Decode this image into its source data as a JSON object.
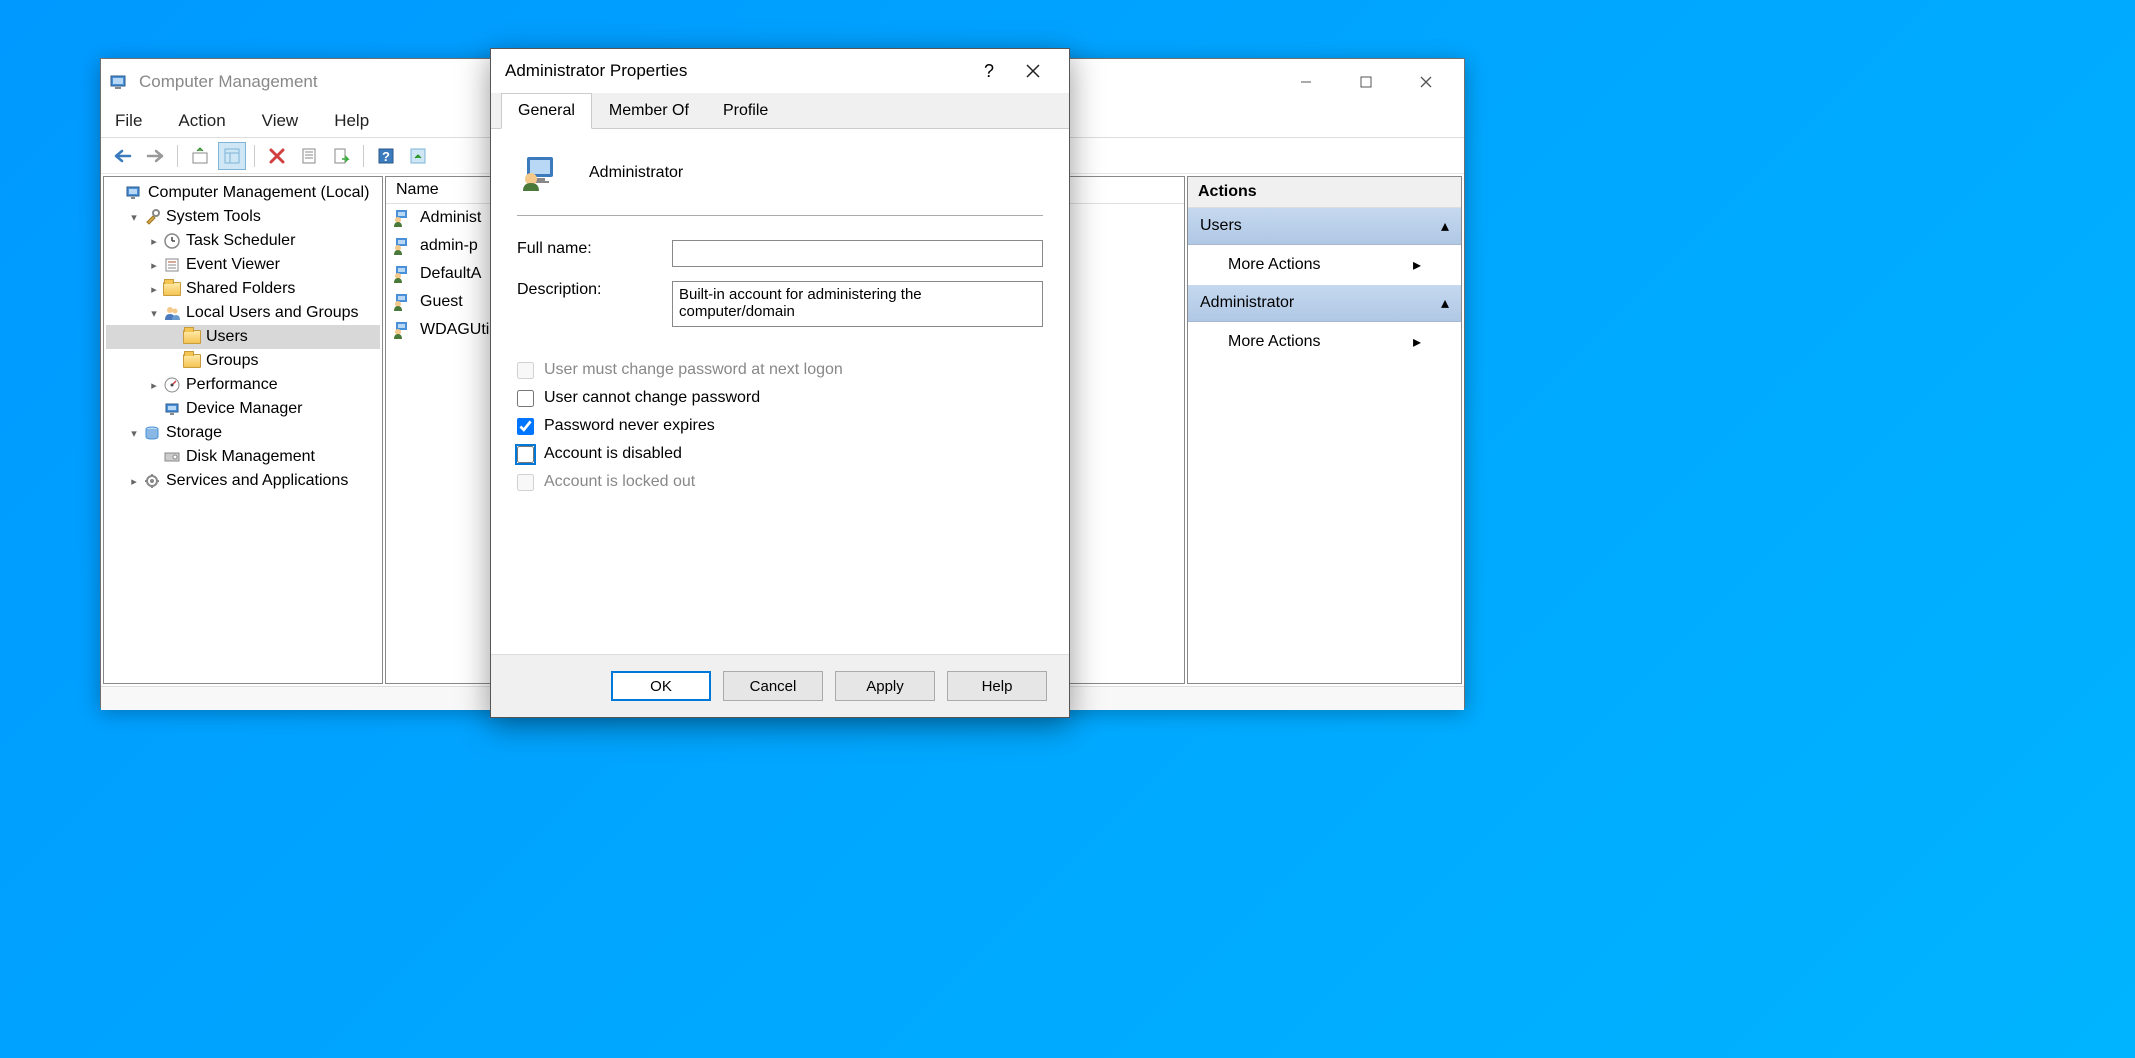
{
  "mainWindow": {
    "title": "Computer Management",
    "menu": [
      "File",
      "Action",
      "View",
      "Help"
    ],
    "tree": [
      {
        "label": "Computer Management (Local)",
        "indent": 0,
        "chev": "",
        "icon": "mgmt"
      },
      {
        "label": "System Tools",
        "indent": 1,
        "chev": "v",
        "icon": "tools"
      },
      {
        "label": "Task Scheduler",
        "indent": 2,
        "chev": ">",
        "icon": "clock"
      },
      {
        "label": "Event Viewer",
        "indent": 2,
        "chev": ">",
        "icon": "event"
      },
      {
        "label": "Shared Folders",
        "indent": 2,
        "chev": ">",
        "icon": "folder"
      },
      {
        "label": "Local Users and Groups",
        "indent": 2,
        "chev": "v",
        "icon": "users"
      },
      {
        "label": "Users",
        "indent": 3,
        "chev": "",
        "icon": "folder",
        "selected": true
      },
      {
        "label": "Groups",
        "indent": 3,
        "chev": "",
        "icon": "folder"
      },
      {
        "label": "Performance",
        "indent": 2,
        "chev": ">",
        "icon": "perf"
      },
      {
        "label": "Device Manager",
        "indent": 2,
        "chev": "",
        "icon": "device"
      },
      {
        "label": "Storage",
        "indent": 1,
        "chev": "v",
        "icon": "storage"
      },
      {
        "label": "Disk Management",
        "indent": 2,
        "chev": "",
        "icon": "disk"
      },
      {
        "label": "Services and Applications",
        "indent": 1,
        "chev": ">",
        "icon": "services"
      }
    ],
    "listHeader": "Name",
    "listItems": [
      "Administ",
      "admin-p",
      "DefaultA",
      "Guest",
      "WDAGUti"
    ],
    "actions": {
      "title": "Actions",
      "sections": [
        {
          "header": "Users",
          "items": [
            "More Actions"
          ]
        },
        {
          "header": "Administrator",
          "items": [
            "More Actions"
          ]
        }
      ]
    }
  },
  "dialog": {
    "title": "Administrator Properties",
    "tabs": [
      "General",
      "Member Of",
      "Profile"
    ],
    "activeTab": 0,
    "userName": "Administrator",
    "fields": {
      "fullNameLabel": "Full name:",
      "fullNameValue": "",
      "descriptionLabel": "Description:",
      "descriptionValue": "Built-in account for administering the computer/domain"
    },
    "checks": [
      {
        "label": "User must change password at next logon",
        "checked": false,
        "disabled": true
      },
      {
        "label": "User cannot change password",
        "checked": false,
        "disabled": false
      },
      {
        "label": "Password never expires",
        "checked": true,
        "disabled": false
      },
      {
        "label": "Account is disabled",
        "checked": false,
        "disabled": false,
        "focus": true
      },
      {
        "label": "Account is locked out",
        "checked": false,
        "disabled": true
      }
    ],
    "buttons": {
      "ok": "OK",
      "cancel": "Cancel",
      "apply": "Apply",
      "help": "Help"
    }
  }
}
